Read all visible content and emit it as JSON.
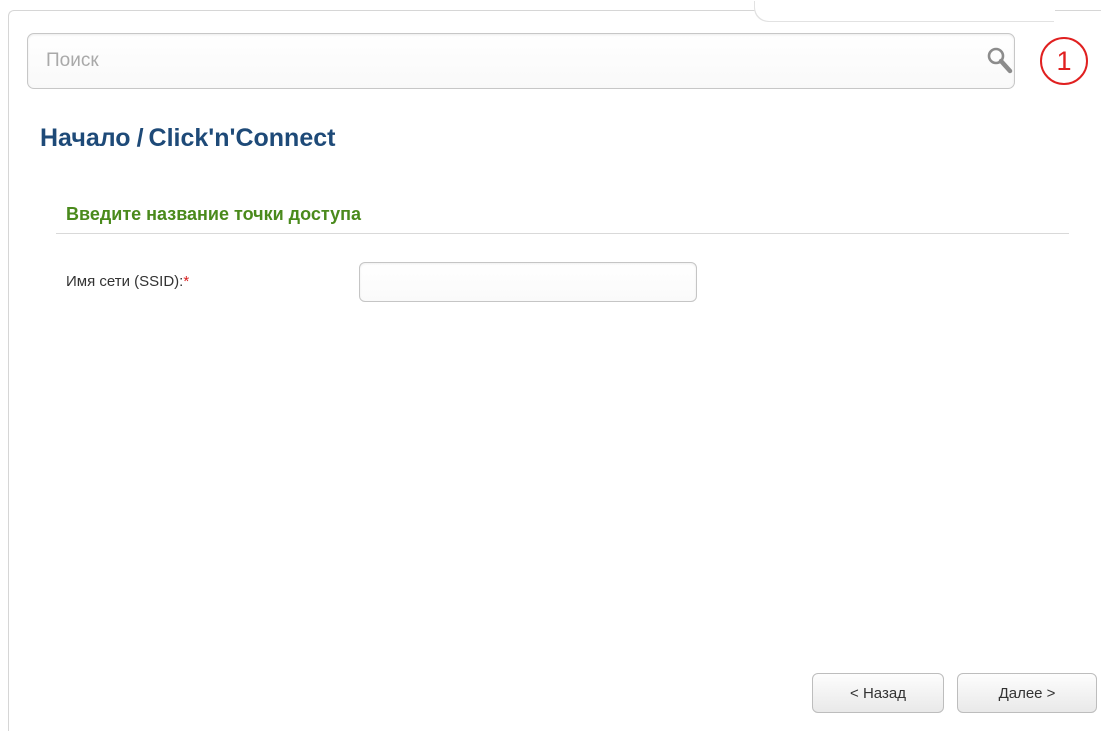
{
  "search": {
    "placeholder": "Поиск",
    "value": "",
    "icon": "search-icon"
  },
  "notifications": {
    "count": "1",
    "color": "#e02020"
  },
  "breadcrumb": {
    "home": "Начало",
    "separator": "/",
    "current": "Click'n'Connect",
    "color": "#1e4a78"
  },
  "section": {
    "title": "Введите название точки доступа",
    "color": "#4a8a1c"
  },
  "form": {
    "ssid_label": "Имя сети (SSID):",
    "required_mark": "*",
    "ssid_value": ""
  },
  "buttons": {
    "back_label": "< Назад",
    "next_label": "Далее >"
  }
}
